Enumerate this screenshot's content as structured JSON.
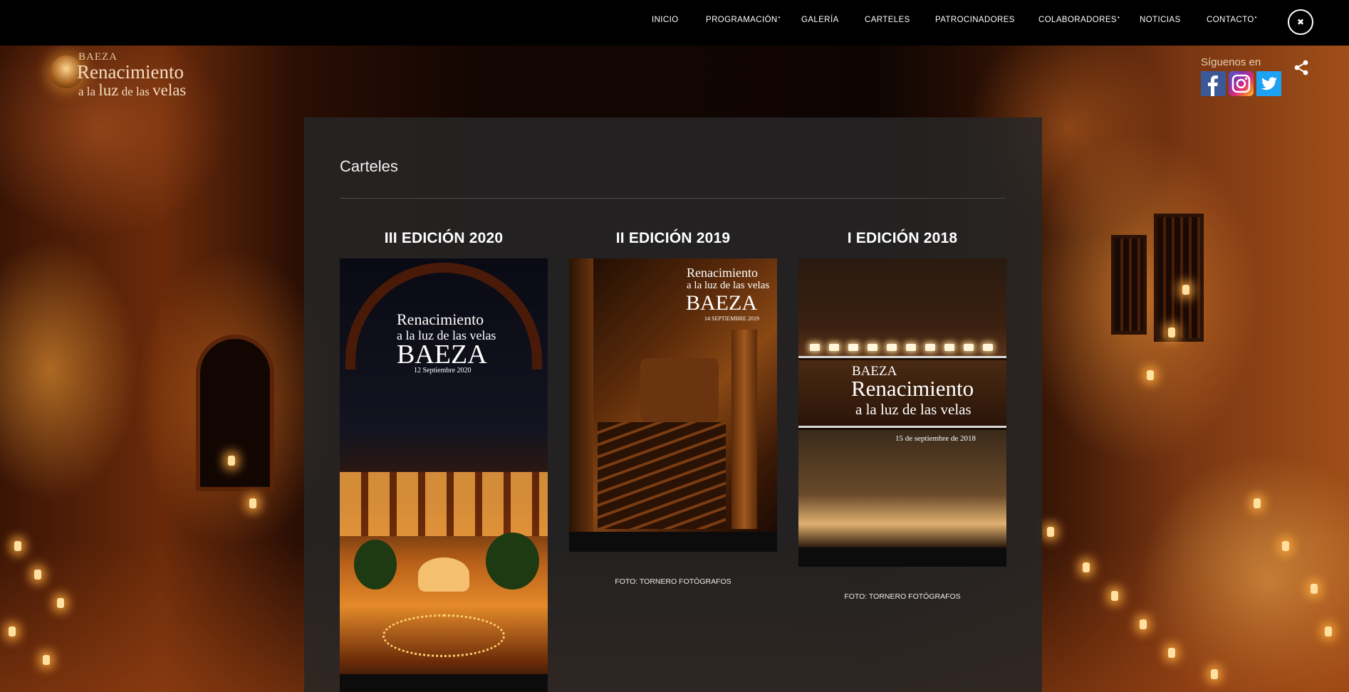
{
  "nav": {
    "items": [
      {
        "label": "INICIO",
        "dropdown": false
      },
      {
        "label": "PROGRAMACIÓN",
        "dropdown": true
      },
      {
        "label": "GALERÍA",
        "dropdown": false
      },
      {
        "label": "CARTELES",
        "dropdown": false
      },
      {
        "label": "PATROCINADORES",
        "dropdown": false
      },
      {
        "label": "COLABORADORES",
        "dropdown": true
      },
      {
        "label": "NOTICIAS",
        "dropdown": false
      },
      {
        "label": "CONTACTO",
        "dropdown": true
      }
    ],
    "close_symbol": "✖"
  },
  "logo": {
    "top": "BAEZA",
    "main": "Renacimiento",
    "sub_a": "a la",
    "sub_luz": "luz",
    "sub_b": "de las",
    "sub_velas": "velas"
  },
  "social": {
    "follow_label": "Síguenos en",
    "networks": [
      "facebook-icon",
      "instagram-icon",
      "twitter-icon"
    ]
  },
  "page": {
    "title": "Carteles"
  },
  "posters": [
    {
      "edition": "III EDICIÓN 2020",
      "credit": "",
      "lines": [
        "Renacimiento",
        "a la luz de las velas",
        "BAEZA",
        "12 Septiembre 2020"
      ]
    },
    {
      "edition": "II EDICIÓN 2019",
      "credit": "FOTO: TORNERO FOTÓGRAFOS",
      "lines": [
        "Renacimiento",
        "a la luz de las velas",
        "BAEZA",
        "14 SEPTIEMBRE 2019"
      ]
    },
    {
      "edition": "I EDICIÓN 2018",
      "credit": "FOTO: TORNERO FOTÓGRAFOS",
      "lines": [
        "BAEZA",
        "Renacimiento",
        "a la luz de las velas",
        "15 de septiembre de 2018"
      ]
    }
  ],
  "colors": {
    "topbar": "#000000",
    "panel": "#262626",
    "text": "#ffffff"
  }
}
